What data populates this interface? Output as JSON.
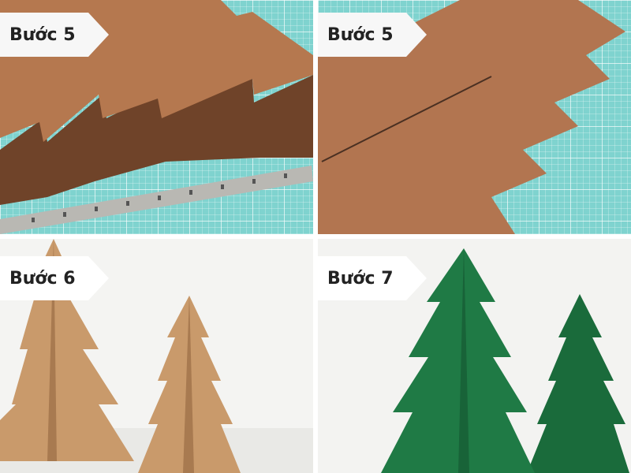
{
  "panels": [
    {
      "label": "Bước 5",
      "scene": "cardboard tree shape cut on cutting mat with metal ruler"
    },
    {
      "label": "Bước 5",
      "scene": "cardboard tree shape with slit on cutting mat"
    },
    {
      "label": "Bước 6",
      "scene": "assembled brown cardboard trees"
    },
    {
      "label": "Bước 7",
      "scene": "painted green cardboard trees"
    }
  ],
  "colors": {
    "mat": "#7fd3cf",
    "cardboard": "#b5784f",
    "cardboard_dark": "#7a4b2e",
    "tree_brown": "#c99a6b",
    "tree_green": "#1f7a45",
    "label_bg": "#f7f7f7"
  }
}
